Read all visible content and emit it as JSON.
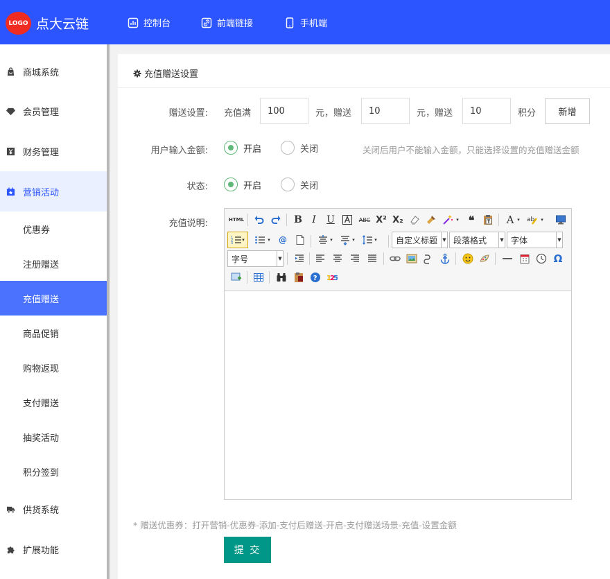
{
  "header": {
    "logo_text": "LOGO",
    "brand": "点大云链",
    "nav": [
      {
        "label": "控制台",
        "icon": "dashboard-icon"
      },
      {
        "label": "前端链接",
        "icon": "link-icon"
      },
      {
        "label": "手机端",
        "icon": "mobile-icon"
      }
    ]
  },
  "sidebar": {
    "items": [
      {
        "label": "商城系统",
        "icon": "bag-icon"
      },
      {
        "label": "会员管理",
        "icon": "diamond-icon"
      },
      {
        "label": "财务管理",
        "icon": "yen-icon"
      },
      {
        "label": "营销活动",
        "icon": "calendar-star-icon"
      }
    ],
    "sub_items": [
      "优惠券",
      "注册赠送",
      "充值赠送",
      "商品促销",
      "购物返现",
      "支付赠送",
      "抽奖活动",
      "积分签到"
    ],
    "bottom_items": [
      {
        "label": "供货系统",
        "icon": "truck-icon"
      },
      {
        "label": "扩展功能",
        "icon": "puzzle-icon"
      }
    ]
  },
  "panel": {
    "title": "充值赠送设置"
  },
  "form": {
    "gift_label": "赠送设置:",
    "recharge_full": "充值满",
    "amount_value": "100",
    "yuan_gift": "元，赠送",
    "money_value": "10",
    "yuan_gift2": "元，赠送",
    "points_value": "10",
    "points_unit": "积分",
    "add_button": "新增",
    "user_input_label": "用户输入金额:",
    "status_label": "状态:",
    "radio_on": "开启",
    "radio_off": "关闭",
    "hint": "关闭后用户不能输入金额，只能选择设置的充值赠送金额",
    "description_label": "充值说明:"
  },
  "editor": {
    "html_btn": "HTML",
    "custom_heading": "自定义标题",
    "paragraph_format": "段落格式",
    "font_family": "字体",
    "font_size": "字号",
    "omega": "Ω"
  },
  "footer": {
    "note": "* 赠送优惠券：打开营销-优惠券-添加-支付后赠送-开启-支付赠送场景-充值-设置金额",
    "submit": "提 交"
  },
  "colors": {
    "header_bg": "#2d55ff",
    "logo_bg": "#f02b22",
    "active_sub_bg": "#4a72ff",
    "submit_bg": "#009688",
    "radio_on": "#5fb878"
  }
}
